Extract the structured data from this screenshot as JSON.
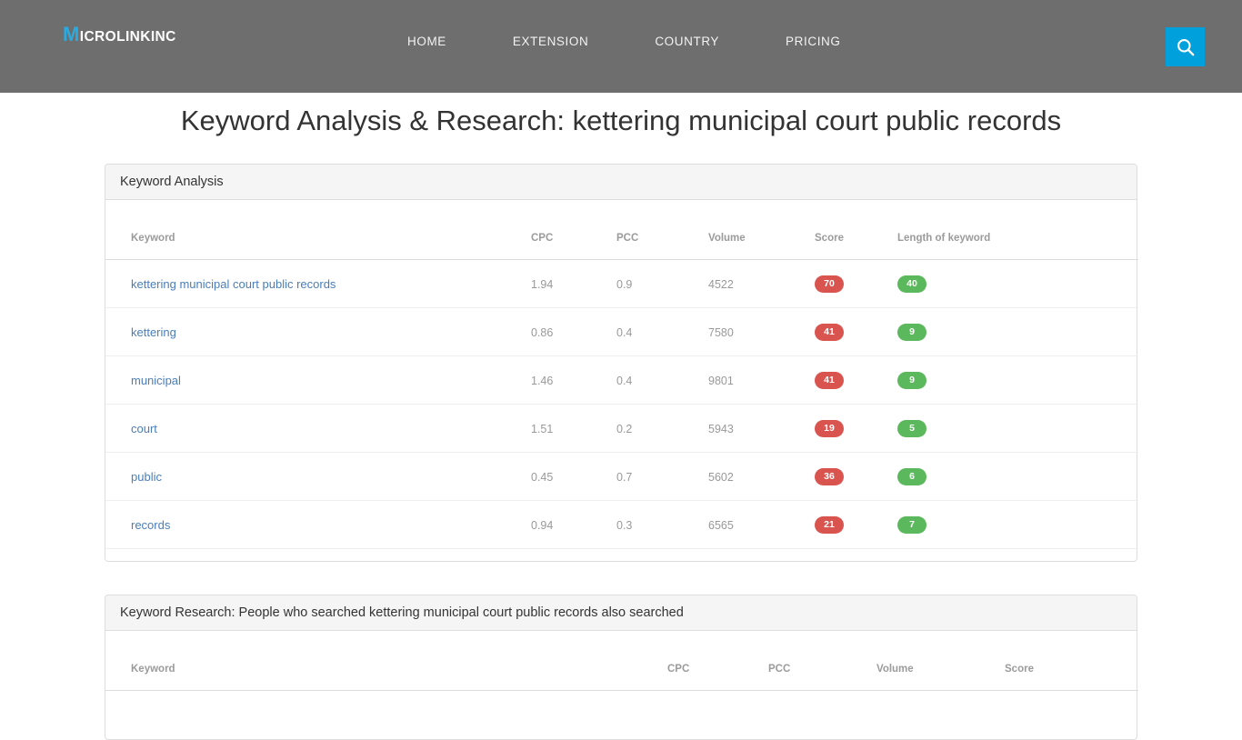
{
  "header": {
    "brand": {
      "initial": "M",
      "rest": "ICROLINKINC",
      "full": "MICROLINKINC"
    },
    "nav": [
      {
        "label": "HOME"
      },
      {
        "label": "EXTENSION"
      },
      {
        "label": "COUNTRY"
      },
      {
        "label": "PRICING"
      }
    ],
    "search_icon": "search-icon",
    "accent_color": "#00a0dd",
    "bar_color": "#6e6e6e"
  },
  "page": {
    "title": "Keyword Analysis & Research: kettering municipal court public records",
    "query": "kettering municipal court public records"
  },
  "analysis_panel": {
    "title": "Keyword Analysis",
    "columns": [
      "Keyword",
      "CPC",
      "PCC",
      "Volume",
      "Score",
      "Length of keyword"
    ],
    "rows": [
      {
        "keyword": "kettering municipal court public records",
        "cpc": "1.94",
        "pcc": "0.9",
        "volume": "4522",
        "score": "70",
        "length": "40"
      },
      {
        "keyword": "kettering",
        "cpc": "0.86",
        "pcc": "0.4",
        "volume": "7580",
        "score": "41",
        "length": "9"
      },
      {
        "keyword": "municipal",
        "cpc": "1.46",
        "pcc": "0.4",
        "volume": "9801",
        "score": "41",
        "length": "9"
      },
      {
        "keyword": "court",
        "cpc": "1.51",
        "pcc": "0.2",
        "volume": "5943",
        "score": "19",
        "length": "5"
      },
      {
        "keyword": "public",
        "cpc": "0.45",
        "pcc": "0.7",
        "volume": "5602",
        "score": "36",
        "length": "6"
      },
      {
        "keyword": "records",
        "cpc": "0.94",
        "pcc": "0.3",
        "volume": "6565",
        "score": "21",
        "length": "7"
      }
    ]
  },
  "research_panel": {
    "title": "Keyword Research: People who searched kettering municipal court public records also searched",
    "columns": [
      "Keyword",
      "CPC",
      "PCC",
      "Volume",
      "Score"
    ],
    "rows": []
  },
  "colors": {
    "score_badge": "#d9534f",
    "length_badge": "#5cb85c",
    "keyword_link": "#4a7ebb"
  }
}
